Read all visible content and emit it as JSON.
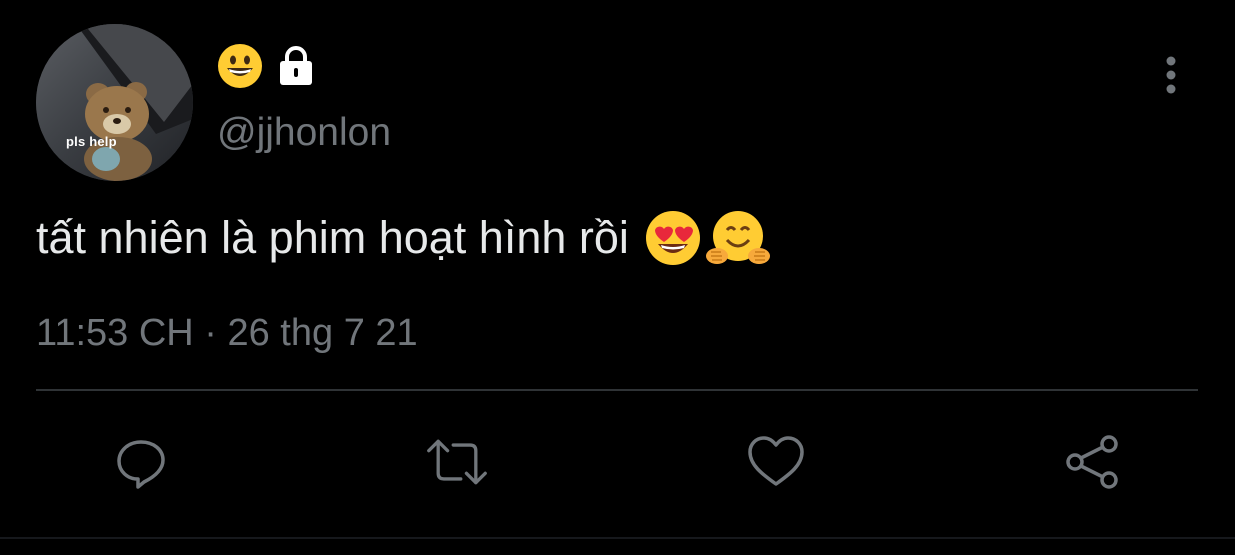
{
  "user": {
    "avatar_caption": "pls help",
    "name_emoji": "grinning-face-emoji",
    "lock_icon": "lock-icon",
    "handle": "@jjhonlon"
  },
  "tweet": {
    "text": "tất nhiên là phim hoạt hình rồi",
    "emojis": [
      "smiling-face-with-heart-eyes-emoji",
      "hugging-face-emoji"
    ],
    "timestamp": "11:53 CH · 26 thg 7 21"
  },
  "actions": [
    {
      "name": "reply",
      "icon": "reply-icon"
    },
    {
      "name": "retweet",
      "icon": "retweet-icon"
    },
    {
      "name": "like",
      "icon": "heart-icon"
    },
    {
      "name": "share",
      "icon": "share-icon"
    }
  ],
  "colors": {
    "background": "#000000",
    "text_primary": "#e7e9ea",
    "text_secondary": "#71767b",
    "divider": "#2f3336",
    "emoji_yellow": "#ffcc33"
  }
}
